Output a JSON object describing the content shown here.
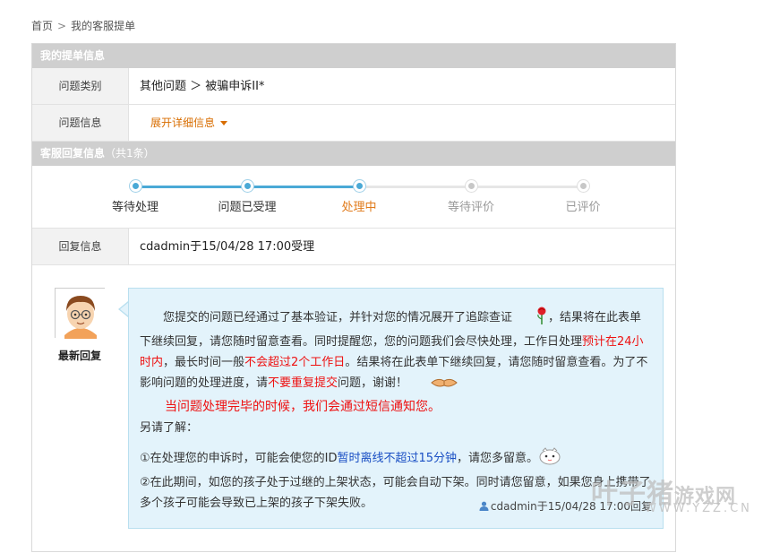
{
  "breadcrumb": {
    "home": "首页",
    "sep": ">",
    "current": "我的客服提单"
  },
  "ticket_section": {
    "title": "我的提单信息"
  },
  "ticket": {
    "category_label": "问题类别",
    "category_value": "其他问题 ＞ 被骗申诉II*",
    "info_label": "问题信息",
    "expand_label": "展开详细信息"
  },
  "reply_section": {
    "title": "客服回复信息",
    "count": "（共1条）"
  },
  "progress": {
    "steps": [
      {
        "label": "等待处理",
        "state": "done"
      },
      {
        "label": "问题已受理",
        "state": "done"
      },
      {
        "label": "处理中",
        "state": "current"
      },
      {
        "label": "等待评价",
        "state": "todo"
      },
      {
        "label": "已评价",
        "state": "todo"
      }
    ]
  },
  "reply_info": {
    "label": "回复信息",
    "value": "cdadmin于15/04/28 17:00受理"
  },
  "reply": {
    "avatar_label": "最新回复",
    "p1_a": "您提交的问题已经通过了基本验证，并针对您的情况展开了追踪查证",
    "p1_b": "，结果将在此表单下继续回复，请您随时留意查看。同时提醒您，您的问题我们会尽快处理，工作日处理",
    "p1_red1": "预计在24小时内",
    "p1_c": "，最长时间一般",
    "p1_red2": "不会超过2个工作日",
    "p1_d": "。结果将在此表单下继续回复，请您随时留意查看。为了不影响问题的处理进度，请",
    "p1_red3": "不要重复提交",
    "p1_e": "问题，谢谢！",
    "notice": "当问题处理完毕的时候，我们会通过短信通知您。",
    "also": "另请了解：",
    "n1_a": "①在处理您的申诉时，可能会使您的ID",
    "n1_blue": "暂时离线不超过15分钟",
    "n1_b": "，请您多留意。",
    "n2": "②在此期间，如您的孩子处于过继的上架状态，可能会自动下架。同时请您留意，如果您身上携带了多个孩子可能会导致已上架的孩子下架失败。",
    "signature": "cdadmin于15/04/28 17:00回复"
  },
  "watermark": {
    "main": "叶子猪",
    "suffix": "游戏网",
    "url": "WWW.YZZ.CN"
  },
  "colors": {
    "accent_blue": "#4aa9d6",
    "current_orange": "#e07a1a",
    "alert_red": "#ee1111",
    "bubble_bg": "#e3f3fb"
  },
  "icons": [
    "rose-icon",
    "handshake-icon",
    "cute-face-icon",
    "person-icon",
    "avatar-icon"
  ]
}
